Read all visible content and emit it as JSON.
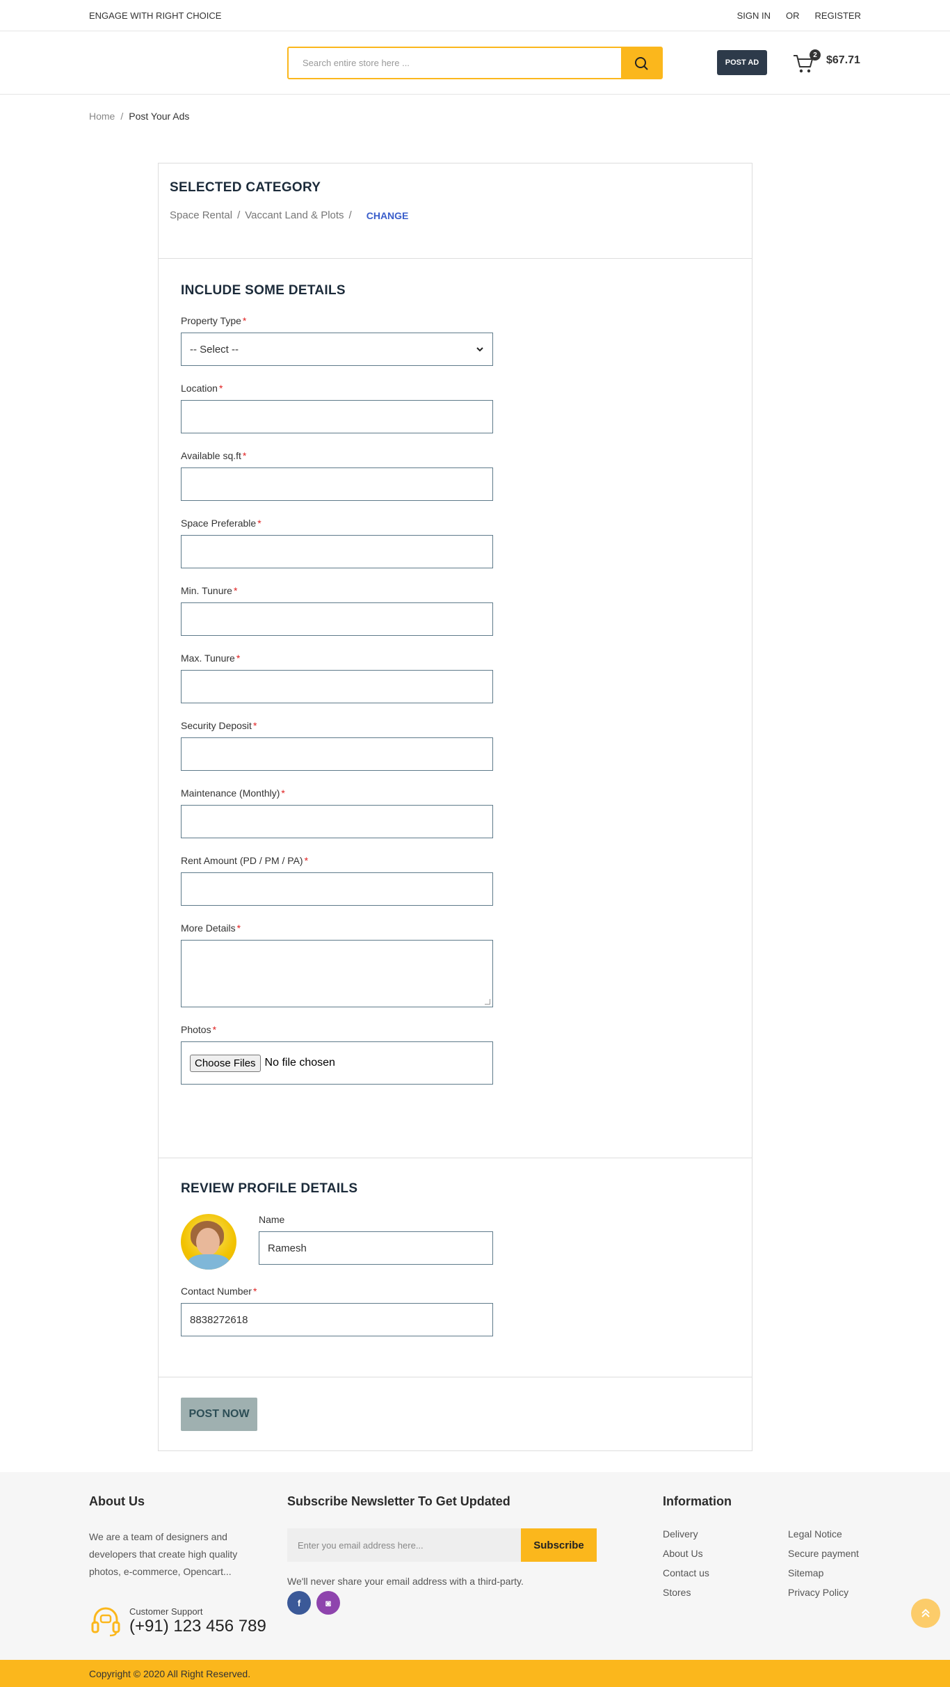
{
  "topbar": {
    "tagline": "ENGAGE WITH RIGHT CHOICE",
    "sign_in": "SIGN IN",
    "or": "OR",
    "register": "REGISTER"
  },
  "header": {
    "search_placeholder": "Search entire store here ...",
    "post_ad": "POST AD",
    "cart_count": "2",
    "cart_amount": "$67.71",
    "accent_color": "#fbb71c"
  },
  "breadcrumb": {
    "home": "Home",
    "separator": "/",
    "current": "Post Your Ads"
  },
  "category": {
    "title": "SELECTED CATEGORY",
    "level1": "Space Rental",
    "level2": "Vaccant Land & Plots",
    "separator": "/",
    "change": "CHANGE"
  },
  "details": {
    "title": "INCLUDE SOME DETAILS",
    "required_mark": "*",
    "property_type": {
      "label": "Property Type",
      "value": "-- Select --"
    },
    "location": {
      "label": "Location",
      "value": ""
    },
    "available_sqft": {
      "label": "Available sq.ft",
      "value": ""
    },
    "space_preferable": {
      "label": "Space Preferable",
      "value": ""
    },
    "min_tenure": {
      "label": "Min. Tunure",
      "value": ""
    },
    "max_tenure": {
      "label": "Max. Tunure",
      "value": ""
    },
    "security_deposit": {
      "label": "Security Deposit",
      "value": ""
    },
    "maintenance": {
      "label": "Maintenance (Monthly)",
      "value": ""
    },
    "rent_amount": {
      "label": "Rent Amount (PD / PM / PA)",
      "value": ""
    },
    "more_details": {
      "label": "More Details",
      "value": ""
    },
    "photos": {
      "label": "Photos",
      "button": "Choose Files",
      "status": "No file chosen"
    }
  },
  "profile": {
    "title": "REVIEW PROFILE DETAILS",
    "name_label": "Name",
    "name_value": "Ramesh",
    "contact_label": "Contact Number",
    "contact_value": "8838272618"
  },
  "submit": {
    "label": "POST NOW"
  },
  "footer": {
    "about_title": "About Us",
    "about_text": "We are a team of designers and developers that create high quality photos, e-commerce, Opencart...",
    "support_label": "Customer Support",
    "support_phone": "(+91) 123 456 789",
    "newsletter_title": "Subscribe Newsletter To Get Updated",
    "newsletter_placeholder": "Enter you email address here...",
    "subscribe": "Subscribe",
    "privacy_note": "We'll never share your email address with a third-party.",
    "social_fb": "f",
    "social_ig": "◙",
    "info_title": "Information",
    "info_links": [
      "Delivery",
      "Legal Notice",
      "About Us",
      "Secure payment",
      "Contact us",
      "Sitemap",
      "Stores",
      "Privacy Policy"
    ],
    "copyright": "Copyright © 2020 All Right Reserved."
  }
}
